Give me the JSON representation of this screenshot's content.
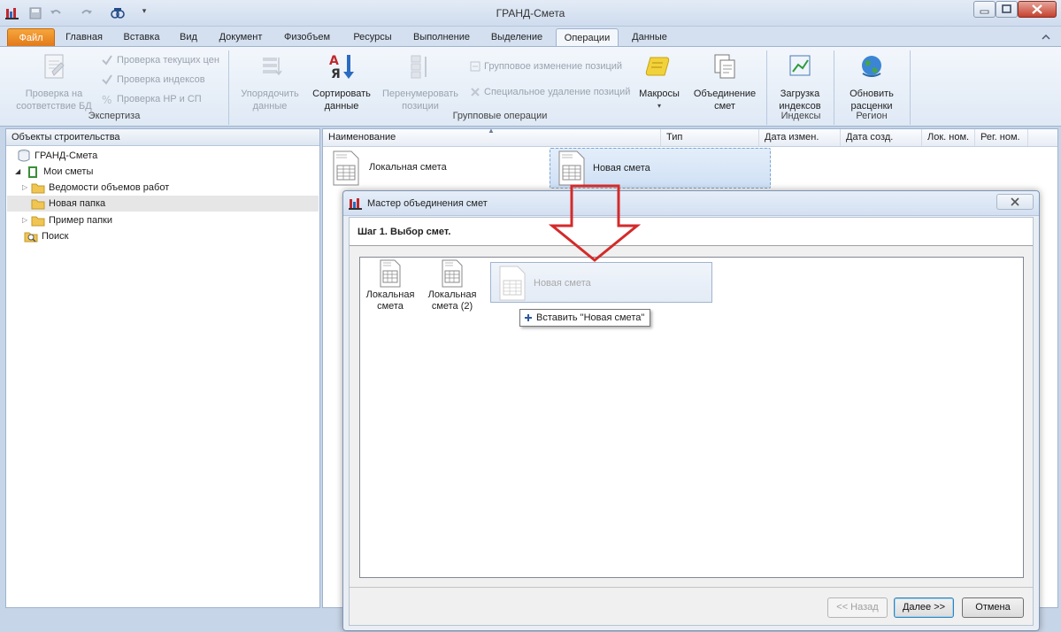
{
  "window": {
    "title": "ГРАНД-Смета"
  },
  "tabs": [
    {
      "label": "Файл"
    },
    {
      "label": "Главная"
    },
    {
      "label": "Вставка"
    },
    {
      "label": "Вид"
    },
    {
      "label": "Документ"
    },
    {
      "label": "Физобъем"
    },
    {
      "label": "Ресурсы"
    },
    {
      "label": "Выполнение"
    },
    {
      "label": "Выделение"
    },
    {
      "label": "Операции"
    },
    {
      "label": "Данные"
    }
  ],
  "ribbon": {
    "expertise": {
      "check_db": "Проверка на соответствие БД",
      "check_prices": "Проверка текущих цен",
      "check_indexes": "Проверка индексов",
      "check_nr": "Проверка НР и СП",
      "label": "Экспертиза"
    },
    "group_ops": {
      "order": "Упорядочить данные",
      "sort": "Сортировать данные",
      "renumber": "Перенумеровать позиции",
      "group_change": "Групповое изменение позиций",
      "special_delete": "Специальное удаление позиций",
      "macros": "Макросы",
      "merge": "Объединение смет",
      "label": "Групповые операции"
    },
    "indexes": {
      "load": "Загрузка индексов",
      "label": "Индексы"
    },
    "region": {
      "update": "Обновить расценки",
      "label": "Регион"
    }
  },
  "left_panel": {
    "header": "Объекты строительства",
    "tree": [
      "ГРАНД-Смета",
      "Мои сметы",
      "Ведомости объемов работ",
      "Новая папка",
      "Пример папки",
      "Поиск"
    ]
  },
  "right_panel": {
    "columns": [
      "Наименование",
      "Тип",
      "Дата измен.",
      "Дата созд.",
      "Лок. ном.",
      "Рег. ном."
    ],
    "items": [
      "Локальная смета",
      "Новая смета"
    ]
  },
  "dialog": {
    "title": "Мастер объединения смет",
    "step": "Шаг 1. Выбор смет.",
    "items": [
      "Локальная смета",
      "Локальная смета (2)"
    ],
    "drag_item": "Новая смета",
    "tooltip": "Вставить \"Новая смета\"",
    "back": "<< Назад",
    "next": "Далее >>",
    "cancel": "Отмена"
  }
}
